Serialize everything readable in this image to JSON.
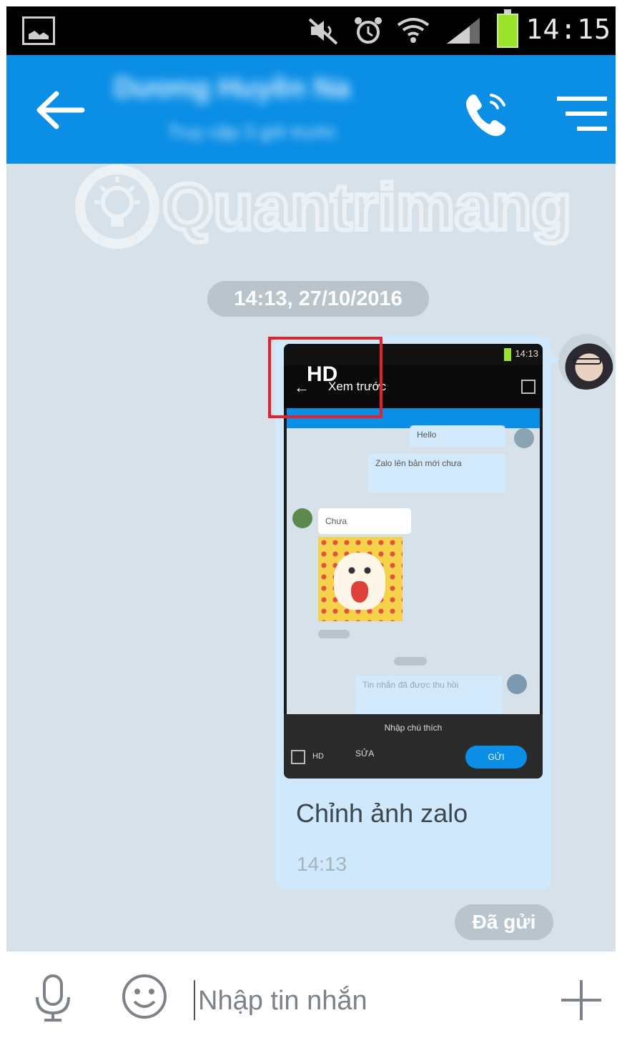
{
  "status_bar": {
    "time": "14:15",
    "icons": [
      "gallery-icon",
      "mute-icon",
      "alarm-icon",
      "wifi-icon",
      "signal-icon",
      "battery-icon"
    ]
  },
  "header": {
    "contact_name": "Dương Huyền Na",
    "contact_status": "Truy cập 3 giờ trước",
    "icons": [
      "back-arrow-icon",
      "phone-icon",
      "menu-icon"
    ],
    "color": "#0a8ee6"
  },
  "watermark": "Quantrimang",
  "chat": {
    "date_separator": "14:13, 27/10/2016",
    "message": {
      "caption": "Chỉnh ảnh zalo",
      "time": "14:13",
      "status": "Đã gửi",
      "image_overlay_label": "HD"
    },
    "embedded_screenshot": {
      "time": "14:13",
      "title": "Xem trước",
      "messages": [
        "Hello",
        "Zalo lên bản mới chưa",
        "Chưa",
        "Tin nhắn đã được thu hồi"
      ],
      "caption_placeholder": "Nhập chú thích",
      "hd_label": "HD",
      "edit_label": "SỬA",
      "send_label": "GỬI"
    }
  },
  "input_bar": {
    "placeholder": "Nhập tin nhắn",
    "value": "",
    "icons": [
      "microphone-icon",
      "emoji-icon",
      "plus-icon"
    ]
  },
  "colors": {
    "accent": "#0a8ee6",
    "chat_background": "#d6e1ea",
    "bubble": "#cfe8fb",
    "highlight": "#e8202a"
  }
}
